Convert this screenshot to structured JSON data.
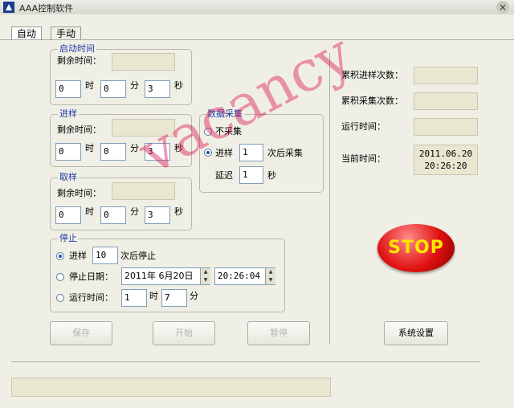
{
  "window": {
    "title": "AAA控制软件",
    "close": "×"
  },
  "tabs": [
    {
      "label": "自动"
    },
    {
      "label": "手动"
    }
  ],
  "start_time": {
    "title": "启动时间",
    "remaining_label": "剩余时间：",
    "hour": "0",
    "hour_unit": "时",
    "min": "0",
    "min_unit": "分",
    "sec": "3",
    "sec_unit": "秒"
  },
  "feed": {
    "title": "进样",
    "remaining_label": "剩余时间：",
    "hour": "0",
    "hour_unit": "时",
    "min": "0",
    "min_unit": "分",
    "sec": "3",
    "sec_unit": "秒"
  },
  "sample": {
    "title": "取样",
    "remaining_label": "剩余时间：",
    "hour": "0",
    "hour_unit": "时",
    "min": "0",
    "min_unit": "分",
    "sec": "3",
    "sec_unit": "秒"
  },
  "acquisition": {
    "title": "数据采集",
    "no_collect": "不采集",
    "feed_label": "进样",
    "feed_count": "1",
    "after_label": "次后采集",
    "delay_label": "延迟",
    "delay_value": "1",
    "delay_unit": "秒"
  },
  "stop_group": {
    "title": "停止",
    "feed_label": "进样",
    "feed_count": "10",
    "after_label": "次后停止",
    "date_label": "停止日期：",
    "date_value": "2011年 6月20日",
    "time_value": "20:26:04",
    "run_label": "运行时间：",
    "run_hour": "1",
    "hour_unit": "时",
    "run_min": "7",
    "min_unit": "分"
  },
  "buttons": {
    "save": "保存",
    "start": "开始",
    "pause": "暂停",
    "settings": "系统设置",
    "stop": "STOP"
  },
  "stats": {
    "feed_count_label": "累积进样次数：",
    "collect_count_label": "累积采集次数：",
    "run_time_label": "运行时间：",
    "current_time_label": "当前时间：",
    "current_date": "2011.06.20",
    "current_time": "20:26:20"
  },
  "watermark": "vacancy",
  "colors": {
    "group_title": "#1a3aa8",
    "readonly_bg": "#e9e7cf",
    "stop_red": "#e01010",
    "stop_text": "#ffe600",
    "watermark": "#dc1e5a"
  }
}
